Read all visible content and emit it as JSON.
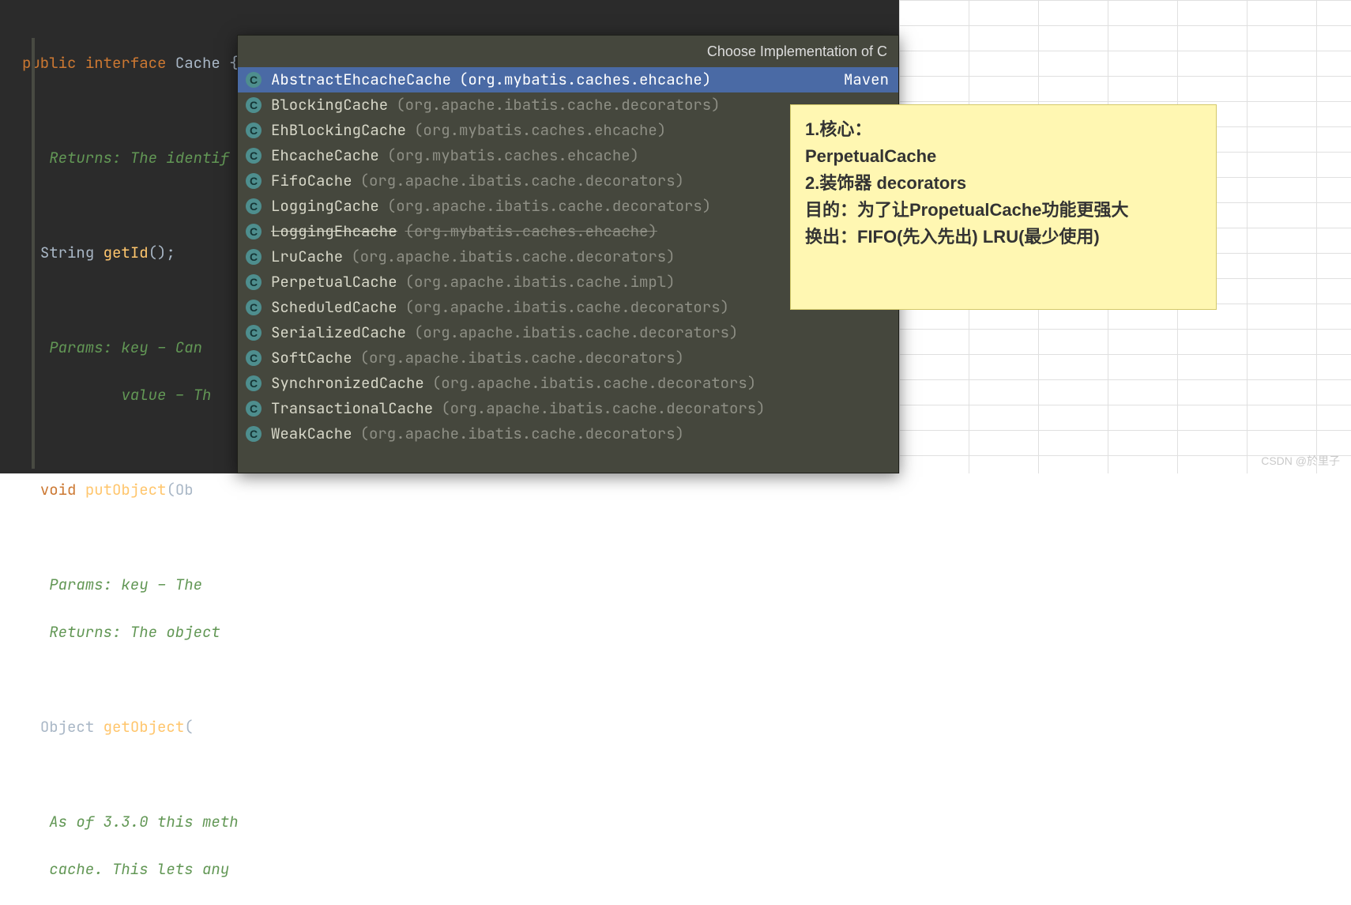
{
  "editor": {
    "l1_kw1": "public ",
    "l1_kw2": "interface ",
    "l1_name": "Cache",
    "l1_brace": " {",
    "doc1": "Returns: The identif",
    "l2_type": "String ",
    "l2_name": "getId",
    "l2_tail": "();",
    "doc2a": "Params: key – Can ",
    "doc2b": "        value – Th",
    "l3_kw": "void ",
    "l3_name": "putObject",
    "l3_tail": "(Ob",
    "doc3a": "Params: key – The ",
    "doc3b": "Returns: The object",
    "l4_type": "Object ",
    "l4_name": "getObject",
    "l4_tail": "(",
    "doc4a": "As of 3.3.0 this meth",
    "doc4b": "cache. This lets any"
  },
  "popup": {
    "title": "Choose Implementation of C",
    "items": [
      {
        "name": "AbstractEhcacheCache",
        "pkg": "(org.mybatis.caches.ehcache)",
        "tag": "Maven",
        "sel": true,
        "strike": false
      },
      {
        "name": "BlockingCache",
        "pkg": "(org.apache.ibatis.cache.decorators)",
        "tag": "",
        "sel": false,
        "strike": false
      },
      {
        "name": "EhBlockingCache",
        "pkg": "(org.mybatis.caches.ehcache)",
        "tag": "",
        "sel": false,
        "strike": false
      },
      {
        "name": "EhcacheCache",
        "pkg": "(org.mybatis.caches.ehcache)",
        "tag": "",
        "sel": false,
        "strike": false
      },
      {
        "name": "FifoCache",
        "pkg": "(org.apache.ibatis.cache.decorators)",
        "tag": "",
        "sel": false,
        "strike": false
      },
      {
        "name": "LoggingCache",
        "pkg": "(org.apache.ibatis.cache.decorators)",
        "tag": "",
        "sel": false,
        "strike": false
      },
      {
        "name": "LoggingEhcache",
        "pkg": "(org.mybatis.caches.ehcache)",
        "tag": "",
        "sel": false,
        "strike": true
      },
      {
        "name": "LruCache",
        "pkg": "(org.apache.ibatis.cache.decorators)",
        "tag": "",
        "sel": false,
        "strike": false
      },
      {
        "name": "PerpetualCache",
        "pkg": "(org.apache.ibatis.cache.impl)",
        "tag": "",
        "sel": false,
        "strike": false
      },
      {
        "name": "ScheduledCache",
        "pkg": "(org.apache.ibatis.cache.decorators)",
        "tag": "",
        "sel": false,
        "strike": false
      },
      {
        "name": "SerializedCache",
        "pkg": "(org.apache.ibatis.cache.decorators)",
        "tag": "",
        "sel": false,
        "strike": false
      },
      {
        "name": "SoftCache",
        "pkg": "(org.apache.ibatis.cache.decorators)",
        "tag": "",
        "sel": false,
        "strike": false
      },
      {
        "name": "SynchronizedCache",
        "pkg": "(org.apache.ibatis.cache.decorators)",
        "tag": "",
        "sel": false,
        "strike": false
      },
      {
        "name": "TransactionalCache",
        "pkg": "(org.apache.ibatis.cache.decorators)",
        "tag": "",
        "sel": false,
        "strike": false
      },
      {
        "name": "WeakCache",
        "pkg": "(org.apache.ibatis.cache.decorators)",
        "tag": "",
        "sel": false,
        "strike": false
      }
    ],
    "icon_letter": "C"
  },
  "note": {
    "l1": "1.核心：",
    "l2": "PerpetualCache",
    "l3": "2.装饰器 decorators",
    "l4": "目的：为了让PropetualCache功能更强大",
    "l5": "换出：FIFO(先入先出)   LRU(最少使用)"
  },
  "watermark": "CSDN @於里子"
}
